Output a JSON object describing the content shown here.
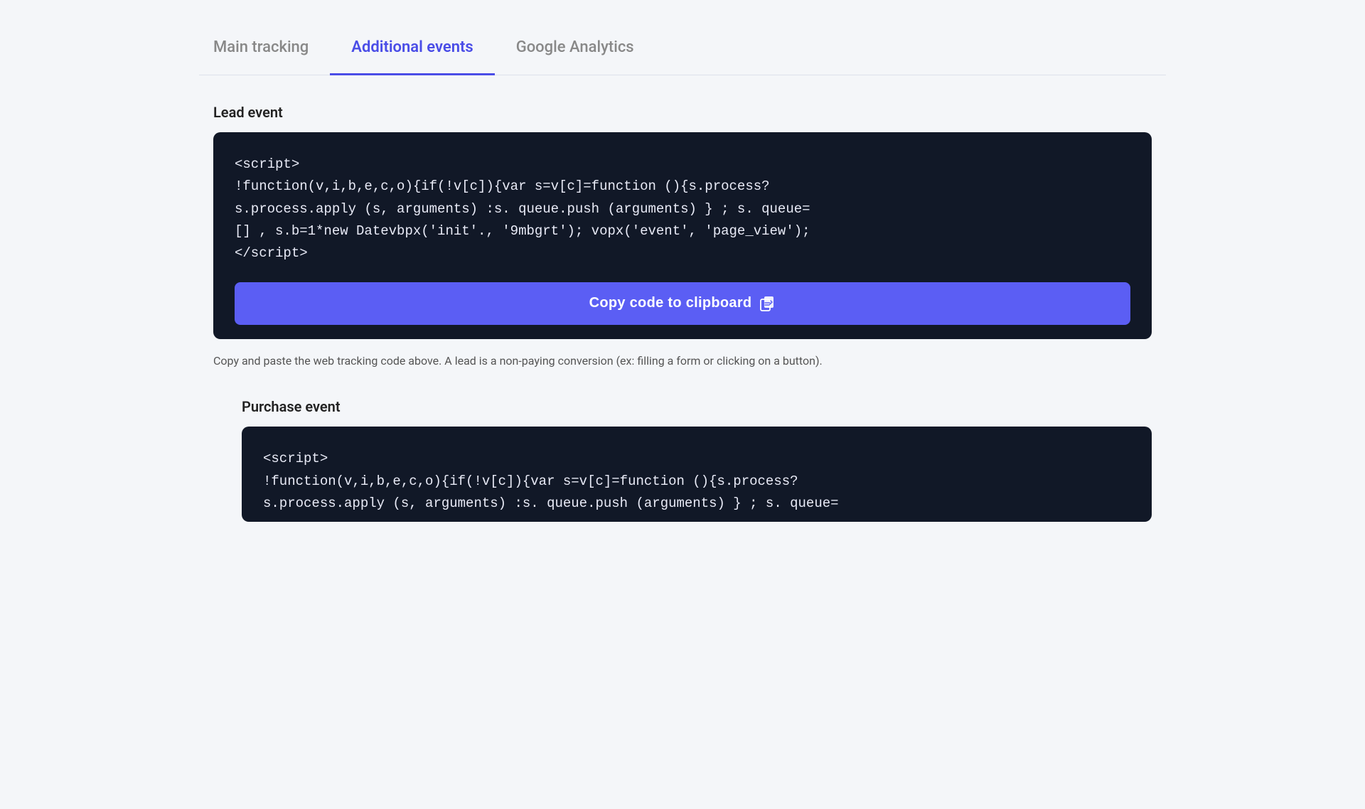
{
  "tabs": [
    {
      "id": "main-tracking",
      "label": "Main tracking",
      "active": false
    },
    {
      "id": "additional-events",
      "label": "Additional events",
      "active": true
    },
    {
      "id": "google-analytics",
      "label": "Google Analytics",
      "active": false
    }
  ],
  "lead_section": {
    "title": "Lead event",
    "code": "<script>\n!function(v,i,b,e,c,o){if(!v[c]){var s=v[c]=function (){s.process?\ns.process.apply (s, arguments) :s. queue.push (arguments) } ; s. queue=\n[] , s.b=1*new Datevbpx('init'., '9mbgrt'); vopx('event', 'page_view');\n</script>",
    "copy_button_label": "Copy code to clipboard",
    "description": "Copy and paste the web tracking code above. A lead is a non-paying conversion (ex: filling a form or clicking on a button)."
  },
  "purchase_section": {
    "title": "Purchase event",
    "code": "<script>\n!function(v,i,b,e,c,o){if(!v[c]){var s=v[c]=function (){s.process?\ns.process.apply (s, arguments) :s. queue.push (arguments) } ; s. queue="
  }
}
